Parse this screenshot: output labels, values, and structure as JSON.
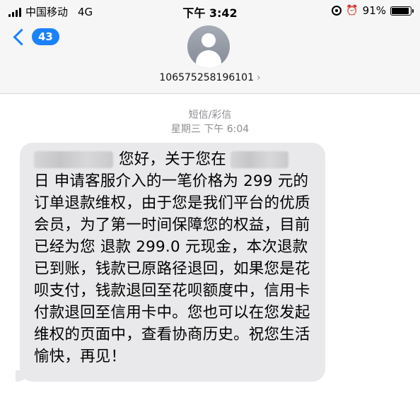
{
  "status_bar": {
    "carrier": "中国移动",
    "network": "4G",
    "time": "下午 3:42",
    "battery_percent": "91%",
    "battery_level": 0.91
  },
  "nav": {
    "back_count": "43",
    "contact_number": "106575258196101",
    "accent_color": "#1a82fb"
  },
  "conversation": {
    "message_type": "短信/彩信",
    "timestamp": "星期三 下午 6:04",
    "message": {
      "part1": "您好，关于您在",
      "part2": "日 申请客服介入的一笔价格为 299 元的订单退款维权，由于您是我们平台的优质会员，为了第一时间保障您的权益，目前已经为您 退款 299.0 元现金，本次退款已到账，钱款已原路径退回，如果您是花呗支付，钱款退回至花呗额度中，信用卡付款退回至信用卡中。您也可以在您发起维权的页面中，查看协商历史。祝您生活愉快，再见！"
    }
  }
}
